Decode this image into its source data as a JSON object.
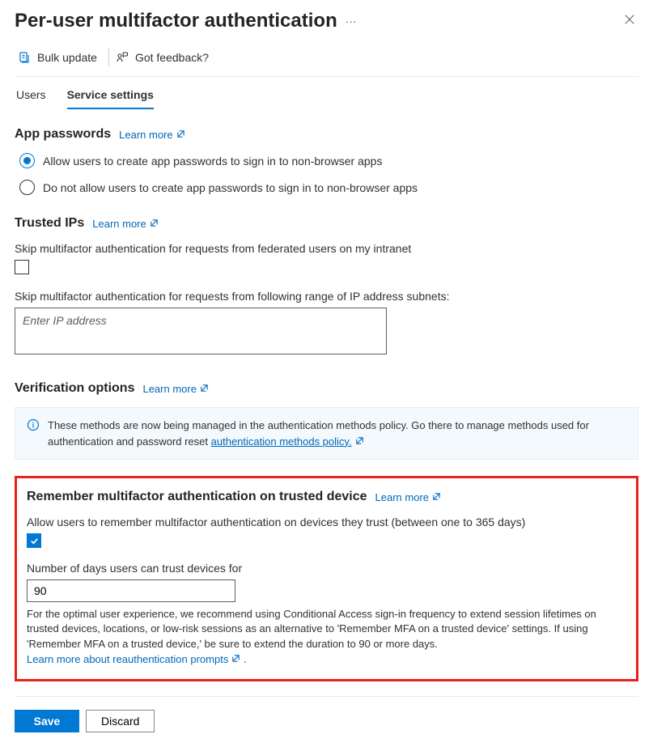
{
  "header": {
    "title": "Per-user multifactor authentication"
  },
  "toolbar": {
    "bulk_update": "Bulk update",
    "feedback": "Got feedback?"
  },
  "tabs": {
    "users": "Users",
    "service_settings": "Service settings"
  },
  "learn_more": "Learn more",
  "app_passwords": {
    "heading": "App passwords",
    "allow": "Allow users to create app passwords to sign in to non-browser apps",
    "deny": "Do not allow users to create app passwords to sign in to non-browser apps"
  },
  "trusted_ips": {
    "heading": "Trusted IPs",
    "skip_federated": "Skip multifactor authentication for requests from federated users on my intranet",
    "skip_subnets": "Skip multifactor authentication for requests from following range of IP address subnets:",
    "placeholder": "Enter IP address"
  },
  "verification": {
    "heading": "Verification options",
    "info_text": "These methods are now being managed in the authentication methods policy. Go there to manage methods used for authentication and password reset ",
    "info_link": "authentication methods policy."
  },
  "remember": {
    "heading": "Remember multifactor authentication on trusted device",
    "allow_label": "Allow users to remember multifactor authentication on devices they trust (between one to 365 days)",
    "days_label": "Number of days users can trust devices for",
    "days_value": "90",
    "help_text_pre": "For the optimal user experience, we recommend using Conditional Access sign-in frequency to extend session lifetimes on trusted devices, locations, or low-risk sessions as an alternative to 'Remember MFA on a trusted device' settings. If using 'Remember MFA on a trusted device,' be sure to extend the duration to 90 or more days. ",
    "help_link": "Learn more about reauthentication prompts"
  },
  "footer": {
    "save": "Save",
    "discard": "Discard"
  }
}
